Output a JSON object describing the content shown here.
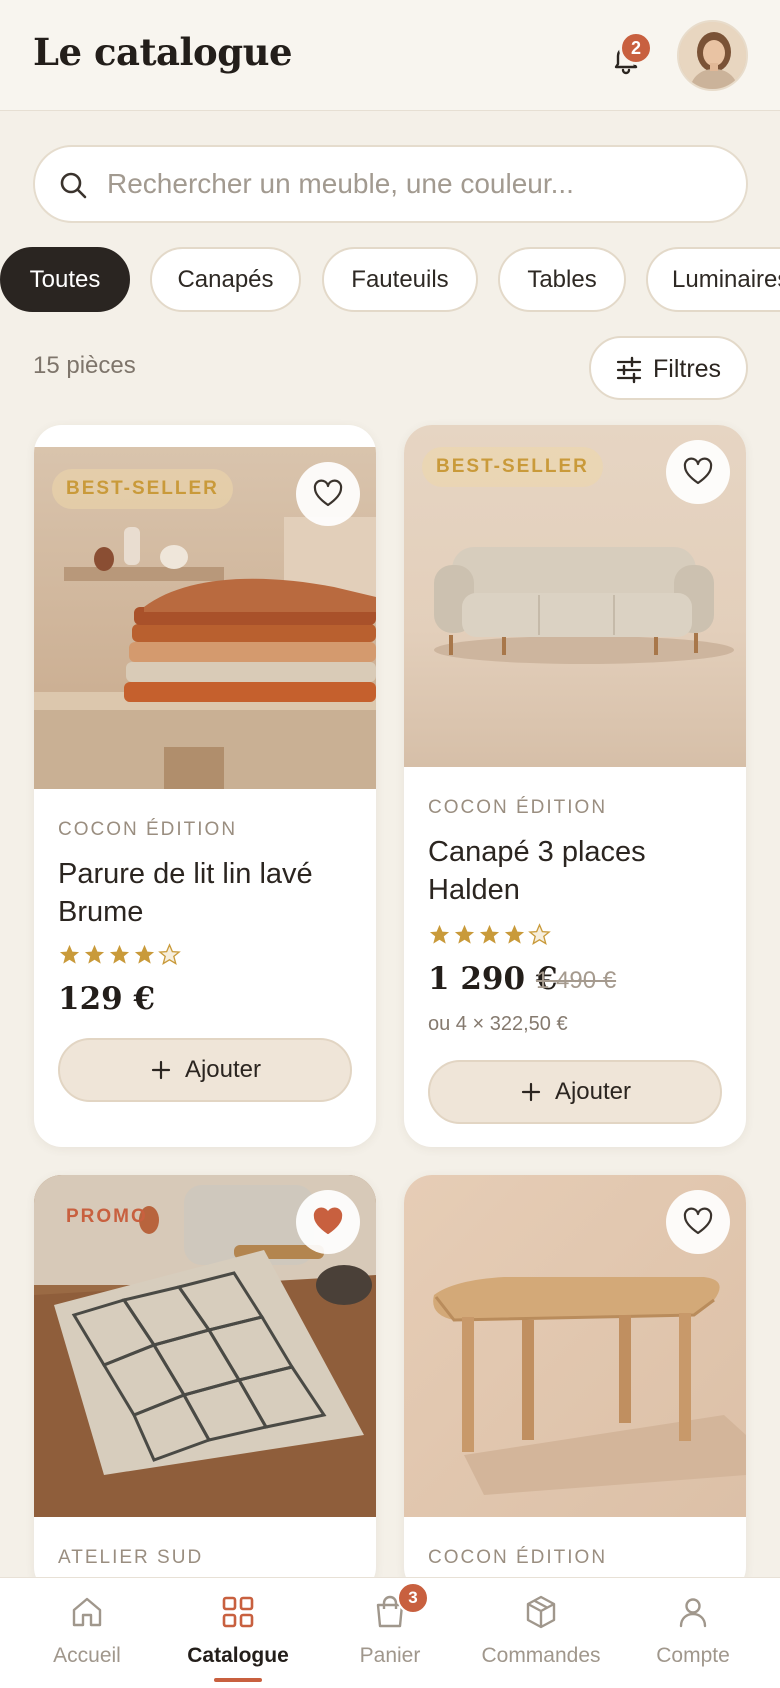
{
  "header": {
    "title": "Le catalogue",
    "notifications_count": "2",
    "bell_icon": "bell-icon",
    "avatar_icon": "avatar"
  },
  "search": {
    "placeholder": "Rechercher un meuble, une couleur...",
    "value": "",
    "icon": "search-icon"
  },
  "categories": [
    {
      "label": "Toutes",
      "active": true
    },
    {
      "label": "Canapés",
      "active": false
    },
    {
      "label": "Fauteuils",
      "active": false
    },
    {
      "label": "Tables",
      "active": false
    },
    {
      "label": "Luminaires",
      "active": false
    }
  ],
  "results": {
    "count_label": "15 pièces",
    "filter_label": "Filtres",
    "filter_icon": "sliders-icon"
  },
  "products": [
    {
      "badge": "BEST-SELLER",
      "brand": "COCON ÉDITION",
      "name": "Parure de lit lin lavé Brume",
      "rating": 4,
      "rating_max": 5,
      "price": "129 €",
      "add_label": "Ajouter",
      "favorite": false
    },
    {
      "badge": "BEST-SELLER",
      "brand": "COCON ÉDITION",
      "name": "Canapé 3 places Halden",
      "rating": 4,
      "rating_max": 5,
      "price": "1 290 €",
      "old_price": "1 490 €",
      "installment": "ou 4 × 322,50 €",
      "add_label": "Ajouter",
      "favorite": false
    },
    {
      "badge": "PROMO",
      "brand": "ATELIER SUD",
      "favorite": true
    },
    {
      "brand": "COCON ÉDITION",
      "favorite": false
    }
  ],
  "bottom_nav": [
    {
      "label": "Accueil",
      "icon": "home-icon",
      "active": false
    },
    {
      "label": "Catalogue",
      "icon": "grid-icon",
      "active": true
    },
    {
      "label": "Panier",
      "icon": "bag-icon",
      "active": false,
      "badge": "3"
    },
    {
      "label": "Commandes",
      "icon": "box-icon",
      "active": false
    },
    {
      "label": "Compte",
      "icon": "user-icon",
      "active": false
    }
  ],
  "colors": {
    "background": "#f4f0e8",
    "accent": "#c8603f",
    "gold": "#c99a3a",
    "dark": "#2a2521"
  }
}
